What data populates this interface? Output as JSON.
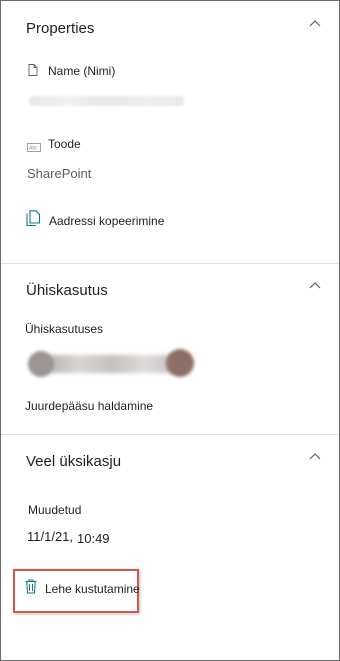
{
  "properties": {
    "title": "Properties",
    "name_label": "Name (Nimi)",
    "type_label": "Toode",
    "type_value": "SharePoint",
    "copy_address": "Aadressi kopeerimine"
  },
  "sharing": {
    "title": "Ühiskasutus",
    "shared_with_label": "Ühiskasutuses",
    "manage_access": "Juurdepääsu haldamine"
  },
  "details": {
    "title": "Veel üksikasju",
    "modified_label": "Muudetud",
    "modified_date": "11/1/21,",
    "modified_time": "10:49",
    "delete_page": "Lehe kustutamine"
  },
  "colors": {
    "accent": "#0f7a8a",
    "highlight_border": "#d9534f",
    "divider": "#e1dfdd"
  },
  "icons": {
    "name": "document-icon",
    "type": "text-field-icon",
    "copy": "copy-icon",
    "delete": "trash-icon",
    "collapse": "chevron-up-icon"
  }
}
